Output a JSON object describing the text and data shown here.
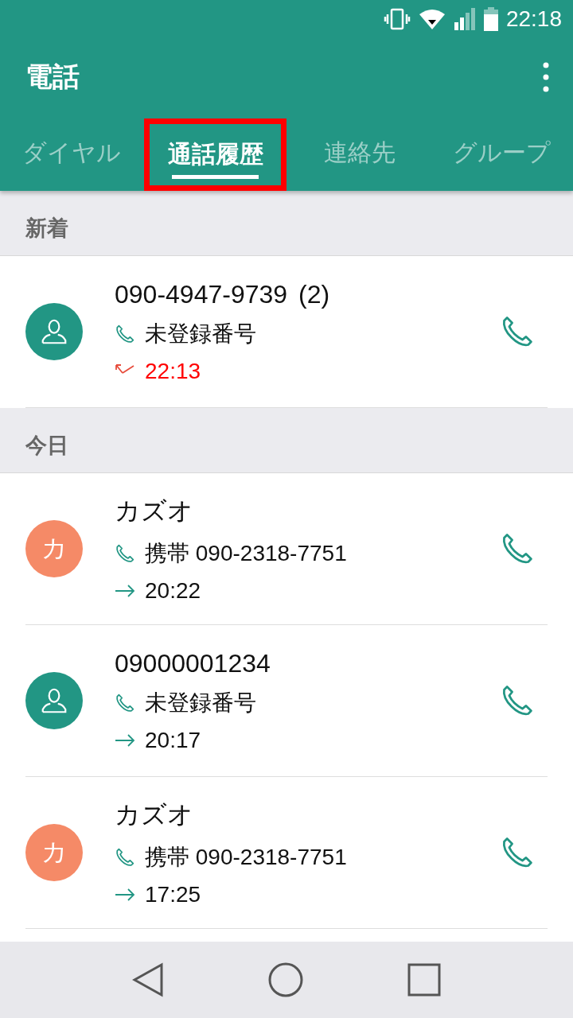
{
  "status_bar": {
    "time": "22:18"
  },
  "app_bar": {
    "title": "電話"
  },
  "tabs": [
    {
      "label": "ダイヤル",
      "selected": false,
      "highlighted": false
    },
    {
      "label": "通話履歴",
      "selected": true,
      "highlighted": true
    },
    {
      "label": "連絡先",
      "selected": false,
      "highlighted": false
    },
    {
      "label": "グループ",
      "selected": false,
      "highlighted": false
    }
  ],
  "sections": [
    {
      "header": "新着",
      "calls": [
        {
          "name": "090-4947-9739",
          "count": "(2)",
          "avatar": {
            "kind": "person"
          },
          "detail": "未登録番号",
          "kind": "missed",
          "time": "22:13"
        }
      ]
    },
    {
      "header": "今日",
      "calls": [
        {
          "name": "カズオ",
          "avatar": {
            "kind": "letter",
            "letter": "カ"
          },
          "detail": "携帯 090-2318-7751",
          "kind": "outgoing",
          "time": "20:22"
        },
        {
          "name": "09000001234",
          "avatar": {
            "kind": "person"
          },
          "detail": "未登録番号",
          "kind": "outgoing",
          "time": "20:17"
        },
        {
          "name": "カズオ",
          "avatar": {
            "kind": "letter",
            "letter": "カ"
          },
          "detail": "携帯 090-2318-7751",
          "kind": "outgoing",
          "time": "17:25"
        }
      ]
    }
  ]
}
